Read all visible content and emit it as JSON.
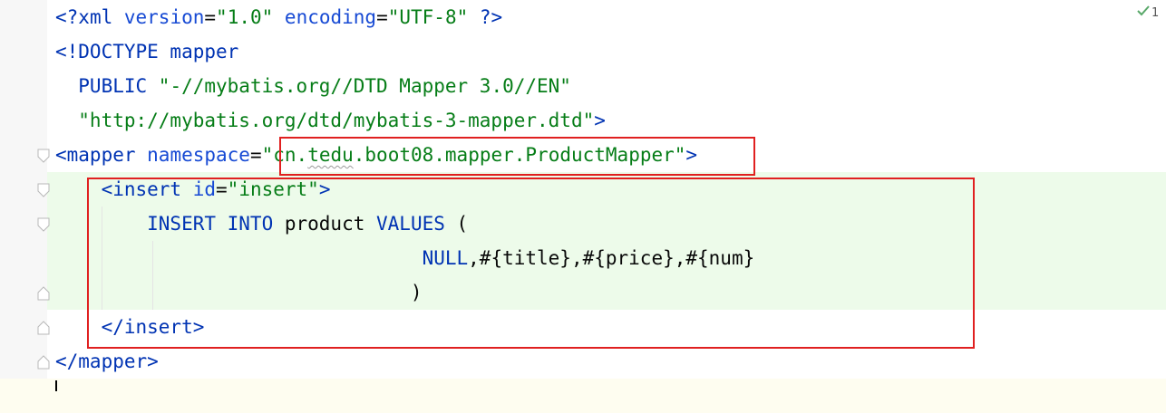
{
  "editor": {
    "inspection_count": "1",
    "lines": [
      {
        "segments": [
          [
            "tag",
            "<?"
          ],
          [
            "tag",
            "xml "
          ],
          [
            "attr",
            "version"
          ],
          [
            "plain",
            "="
          ],
          [
            "str",
            "\"1.0\""
          ],
          [
            "plain",
            " "
          ],
          [
            "attr",
            "encoding"
          ],
          [
            "plain",
            "="
          ],
          [
            "str",
            "\"UTF-8\""
          ],
          [
            "plain",
            " "
          ],
          [
            "tag",
            "?>"
          ]
        ]
      },
      {
        "segments": [
          [
            "tag",
            "<!DOCTYPE mapper"
          ]
        ]
      },
      {
        "segments": [
          [
            "tag",
            "  PUBLIC "
          ],
          [
            "str",
            "\"-//mybatis.org//DTD Mapper 3.0//EN\""
          ]
        ]
      },
      {
        "segments": [
          [
            "str",
            "  \"http://mybatis.org/dtd/mybatis-3-mapper.dtd\""
          ],
          [
            "tag",
            ">"
          ]
        ]
      },
      {
        "segments": [
          [
            "tag",
            "<mapper "
          ],
          [
            "attr",
            "namespace"
          ],
          [
            "plain",
            "="
          ],
          [
            "str",
            "\"cn."
          ],
          [
            "strsq",
            "tedu"
          ],
          [
            "str",
            ".boot08.mapper.ProductMapper\""
          ],
          [
            "tag",
            ">"
          ]
        ]
      },
      {
        "segments": [
          [
            "tag",
            "    <insert "
          ],
          [
            "attr",
            "id"
          ],
          [
            "plain",
            "="
          ],
          [
            "str",
            "\"insert\""
          ],
          [
            "tag",
            ">"
          ]
        ]
      },
      {
        "segments": [
          [
            "kw",
            "        INSERT INTO"
          ],
          [
            "plain",
            " product "
          ],
          [
            "kw",
            "VALUES"
          ],
          [
            "plain",
            " ("
          ]
        ]
      },
      {
        "segments": [
          [
            "kw",
            "                                NULL"
          ],
          [
            "plain",
            ",#{title},#{price},#{num}"
          ]
        ]
      },
      {
        "segments": [
          [
            "plain",
            "                               )"
          ]
        ]
      },
      {
        "segments": [
          [
            "tag",
            "    </insert>"
          ]
        ]
      },
      {
        "segments": [
          [
            "tag",
            "</mapper>"
          ]
        ]
      },
      {
        "segments": []
      }
    ]
  }
}
